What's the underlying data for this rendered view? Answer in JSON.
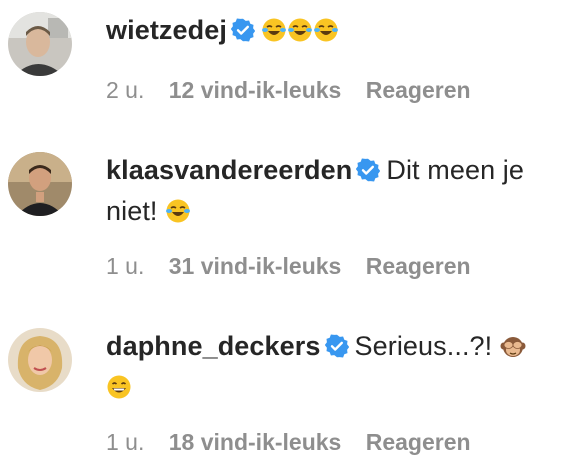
{
  "comments": [
    {
      "username": "wietzedej",
      "text": "",
      "emoji": [
        "face-with-tears-of-joy-emoji",
        "face-with-tears-of-joy-emoji",
        "face-with-tears-of-joy-emoji"
      ],
      "time": "2 u.",
      "likes": "12 vind-ik-leuks",
      "reply": "Reageren"
    },
    {
      "username": "klaasvandereerden",
      "text_line1": "Dit meen je",
      "text_line2": "niet!",
      "emoji": [
        "face-with-tears-of-joy-emoji"
      ],
      "time": "1 u.",
      "likes": "31 vind-ik-leuks",
      "reply": "Reageren"
    },
    {
      "username": "daphne_deckers",
      "text": "Serieus...?!",
      "emoji": [
        "see-no-evil-monkey-emoji",
        "grinning-face-emoji"
      ],
      "time": "1 u.",
      "likes": "18 vind-ik-leuks",
      "reply": "Reageren"
    }
  ],
  "colors": {
    "text": "#262626",
    "meta": "#8e8e8e",
    "verified": "#3897f0"
  }
}
